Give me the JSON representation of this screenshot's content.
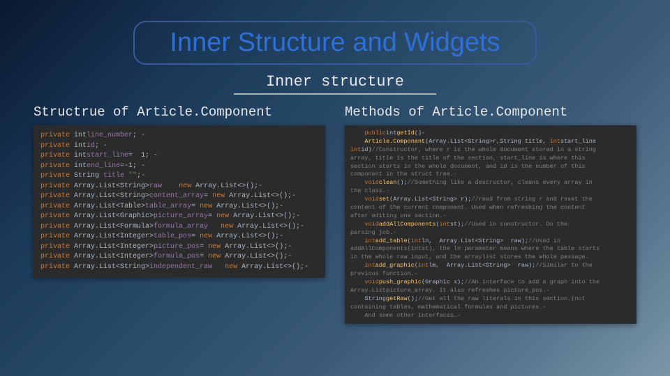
{
  "title": "Inner Structure and Widgets",
  "subtitle": "Inner structure",
  "left": {
    "heading": "Structrue of Article.Component",
    "lines": [
      {
        "s": [
          {
            "c": "kw",
            "t": "private "
          },
          {
            "c": "type",
            "t": "int"
          },
          {
            "c": "ident",
            "t": "line_number"
          },
          {
            "c": "type",
            "t": "; -"
          }
        ]
      },
      {
        "s": [
          {
            "c": "kw",
            "t": "private "
          },
          {
            "c": "type",
            "t": "int"
          },
          {
            "c": "ident",
            "t": "id"
          },
          {
            "c": "type",
            "t": "; -"
          }
        ]
      },
      {
        "s": [
          {
            "c": "kw",
            "t": "private "
          },
          {
            "c": "type",
            "t": "int"
          },
          {
            "c": "ident",
            "t": "start_line"
          },
          {
            "c": "type",
            "t": "=  1; -"
          }
        ]
      },
      {
        "s": [
          {
            "c": "kw",
            "t": "private "
          },
          {
            "c": "type",
            "t": "int"
          },
          {
            "c": "ident",
            "t": "end_line"
          },
          {
            "c": "type",
            "t": "=-1; -"
          }
        ]
      },
      {
        "s": [
          {
            "c": "kw",
            "t": "private "
          },
          {
            "c": "type",
            "t": "String "
          },
          {
            "c": "ident",
            "t": "title "
          },
          {
            "c": "str",
            "t": "\"\""
          },
          {
            "c": "type",
            "t": ";-"
          }
        ]
      },
      {
        "s": [
          {
            "c": "kw",
            "t": "private "
          },
          {
            "c": "type",
            "t": "Array.List<String>"
          },
          {
            "c": "ident",
            "t": "raw    "
          },
          {
            "c": "kw",
            "t": "new "
          },
          {
            "c": "type",
            "t": "Array.List<>();-"
          }
        ]
      },
      {
        "s": [
          {
            "c": "kw",
            "t": "private "
          },
          {
            "c": "type",
            "t": "Array.List<String>"
          },
          {
            "c": "ident",
            "t": "content_array"
          },
          {
            "c": "type",
            "t": "= "
          },
          {
            "c": "kw",
            "t": "new "
          },
          {
            "c": "type",
            "t": "Array.List<>();-"
          }
        ]
      },
      {
        "s": [
          {
            "c": "kw",
            "t": "private "
          },
          {
            "c": "type",
            "t": "Array.List<Table>"
          },
          {
            "c": "ident",
            "t": "table_array"
          },
          {
            "c": "type",
            "t": "= "
          },
          {
            "c": "kw",
            "t": "new "
          },
          {
            "c": "type",
            "t": "Array.List<>();-"
          }
        ]
      },
      {
        "s": [
          {
            "c": "kw",
            "t": "private "
          },
          {
            "c": "type",
            "t": "Array.List<Graphic>"
          },
          {
            "c": "ident",
            "t": "picture_array"
          },
          {
            "c": "type",
            "t": "= "
          },
          {
            "c": "kw",
            "t": "new "
          },
          {
            "c": "type",
            "t": "Array.List<>();-"
          }
        ]
      },
      {
        "s": [
          {
            "c": "kw",
            "t": "private "
          },
          {
            "c": "type",
            "t": "Array.List<Formula>"
          },
          {
            "c": "ident",
            "t": "formula_array   "
          },
          {
            "c": "kw",
            "t": "new "
          },
          {
            "c": "type",
            "t": "Array.List<>();-"
          }
        ]
      },
      {
        "s": [
          {
            "c": "kw",
            "t": "private "
          },
          {
            "c": "type",
            "t": "Array.List<Integer>"
          },
          {
            "c": "ident",
            "t": "table_pos"
          },
          {
            "c": "type",
            "t": "= "
          },
          {
            "c": "kw",
            "t": "new "
          },
          {
            "c": "type",
            "t": "Array.List<>();-"
          }
        ]
      },
      {
        "s": [
          {
            "c": "kw",
            "t": "private "
          },
          {
            "c": "type",
            "t": "Array.List<Integer>"
          },
          {
            "c": "ident",
            "t": "picture_pos"
          },
          {
            "c": "type",
            "t": "= "
          },
          {
            "c": "kw",
            "t": "new "
          },
          {
            "c": "type",
            "t": "Array.List<>();-"
          }
        ]
      },
      {
        "s": [
          {
            "c": "kw",
            "t": "private "
          },
          {
            "c": "type",
            "t": "Array.List<Integer>"
          },
          {
            "c": "ident",
            "t": "formula_pos"
          },
          {
            "c": "type",
            "t": "= "
          },
          {
            "c": "kw",
            "t": "new "
          },
          {
            "c": "type",
            "t": "Array.List<>();-"
          }
        ]
      },
      {
        "s": [
          {
            "c": "kw",
            "t": "private "
          },
          {
            "c": "type",
            "t": "Array.List<String>"
          },
          {
            "c": "ident",
            "t": "independent_raw   "
          },
          {
            "c": "kw",
            "t": "new "
          },
          {
            "c": "type",
            "t": "Array.List<>();-"
          }
        ]
      }
    ]
  },
  "right": {
    "heading": "Methods of Article.Component",
    "lines": [
      {
        "s": [
          {
            "c": "type",
            "t": "    "
          },
          {
            "c": "kw",
            "t": "public"
          },
          {
            "c": "type",
            "t": "int"
          },
          {
            "c": "method",
            "t": "getId"
          },
          {
            "c": "type",
            "t": "()-"
          }
        ]
      },
      {
        "s": [
          {
            "c": "type",
            "t": "    "
          },
          {
            "c": "method",
            "t": "Article.Component"
          },
          {
            "c": "type",
            "t": "(Array.List<String>r,String title, "
          },
          {
            "c": "kw",
            "t": "int"
          },
          {
            "c": "type",
            "t": "start_line"
          }
        ]
      },
      {
        "s": [
          {
            "c": "kw",
            "t": "int"
          },
          {
            "c": "type",
            "t": "id)"
          },
          {
            "c": "comment",
            "t": "//Constructor, where r is the whole document stored in a string"
          }
        ]
      },
      {
        "s": [
          {
            "c": "comment",
            "t": "array, title is the title of the section, start_line is where this"
          }
        ]
      },
      {
        "s": [
          {
            "c": "comment",
            "t": "section starts in the whole document, and id is the number of this"
          }
        ]
      },
      {
        "s": [
          {
            "c": "comment",
            "t": "component in the struct tree.-"
          }
        ]
      },
      {
        "s": [
          {
            "c": "type",
            "t": "    "
          },
          {
            "c": "kw",
            "t": "void"
          },
          {
            "c": "method",
            "t": "clean"
          },
          {
            "c": "type",
            "t": "();"
          },
          {
            "c": "comment",
            "t": "//Something like a destructor, cleans every array in"
          }
        ]
      },
      {
        "s": [
          {
            "c": "comment",
            "t": "the class.-"
          }
        ]
      },
      {
        "s": [
          {
            "c": "type",
            "t": "    "
          },
          {
            "c": "kw",
            "t": "void"
          },
          {
            "c": "method",
            "t": "set"
          },
          {
            "c": "type",
            "t": "(Array.List<String> r);"
          },
          {
            "c": "comment",
            "t": "//read from string r and reset the"
          }
        ]
      },
      {
        "s": [
          {
            "c": "comment",
            "t": "content of the current component. Used when refreshing the content"
          }
        ]
      },
      {
        "s": [
          {
            "c": "comment",
            "t": "after editing one section.-"
          }
        ]
      },
      {
        "s": [
          {
            "c": "type",
            "t": "    "
          },
          {
            "c": "kw",
            "t": "void"
          },
          {
            "c": "method",
            "t": "addAllComponents"
          },
          {
            "c": "type",
            "t": "("
          },
          {
            "c": "kw",
            "t": "int"
          },
          {
            "c": "type",
            "t": "st);"
          },
          {
            "c": "comment",
            "t": "//Used in constructor. Do the"
          }
        ]
      },
      {
        "s": [
          {
            "c": "comment",
            "t": "parsing job.-"
          }
        ]
      },
      {
        "s": [
          {
            "c": "type",
            "t": "    "
          },
          {
            "c": "kw",
            "t": "int"
          },
          {
            "c": "method",
            "t": "add_table"
          },
          {
            "c": "type",
            "t": "("
          },
          {
            "c": "kw",
            "t": "int"
          },
          {
            "c": "type",
            "t": "ln,  Array.List<String>  raw);"
          },
          {
            "c": "comment",
            "t": "//Used in"
          }
        ]
      },
      {
        "s": [
          {
            "c": "comment",
            "t": "addAllComponents(intst), the ln parameter means where the table starts"
          }
        ]
      },
      {
        "s": [
          {
            "c": "comment",
            "t": "in the whole raw input, and the arraylist stores the whole passage."
          }
        ]
      },
      {
        "s": [
          {
            "c": "type",
            "t": "    "
          },
          {
            "c": "kw",
            "t": "int"
          },
          {
            "c": "method",
            "t": "add_graphic"
          },
          {
            "c": "type",
            "t": "("
          },
          {
            "c": "kw",
            "t": "int"
          },
          {
            "c": "type",
            "t": "lm,  Array.List<String>  raw);"
          },
          {
            "c": "comment",
            "t": "//Similar to the"
          }
        ]
      },
      {
        "s": [
          {
            "c": "comment",
            "t": "previous function.-"
          }
        ]
      },
      {
        "s": [
          {
            "c": "type",
            "t": "    "
          },
          {
            "c": "kw",
            "t": "void"
          },
          {
            "c": "method",
            "t": "push_graphic"
          },
          {
            "c": "type",
            "t": "(Graphic x);"
          },
          {
            "c": "comment",
            "t": "//An interface to add a graph into the"
          }
        ]
      },
      {
        "s": [
          {
            "c": "comment",
            "t": "Array.Listpicture_array. It also refreshes picture_pos.-"
          }
        ]
      },
      {
        "s": [
          {
            "c": "type",
            "t": "    String"
          },
          {
            "c": "method",
            "t": "getRaw"
          },
          {
            "c": "type",
            "t": "();"
          },
          {
            "c": "comment",
            "t": "//Get all the raw literals in this section.(not"
          }
        ]
      },
      {
        "s": [
          {
            "c": "comment",
            "t": "containing tables, mathematical formulas and pictures.-"
          }
        ]
      },
      {
        "s": [
          {
            "c": "comment",
            "t": "    And some other interfaces…-"
          }
        ]
      }
    ]
  }
}
